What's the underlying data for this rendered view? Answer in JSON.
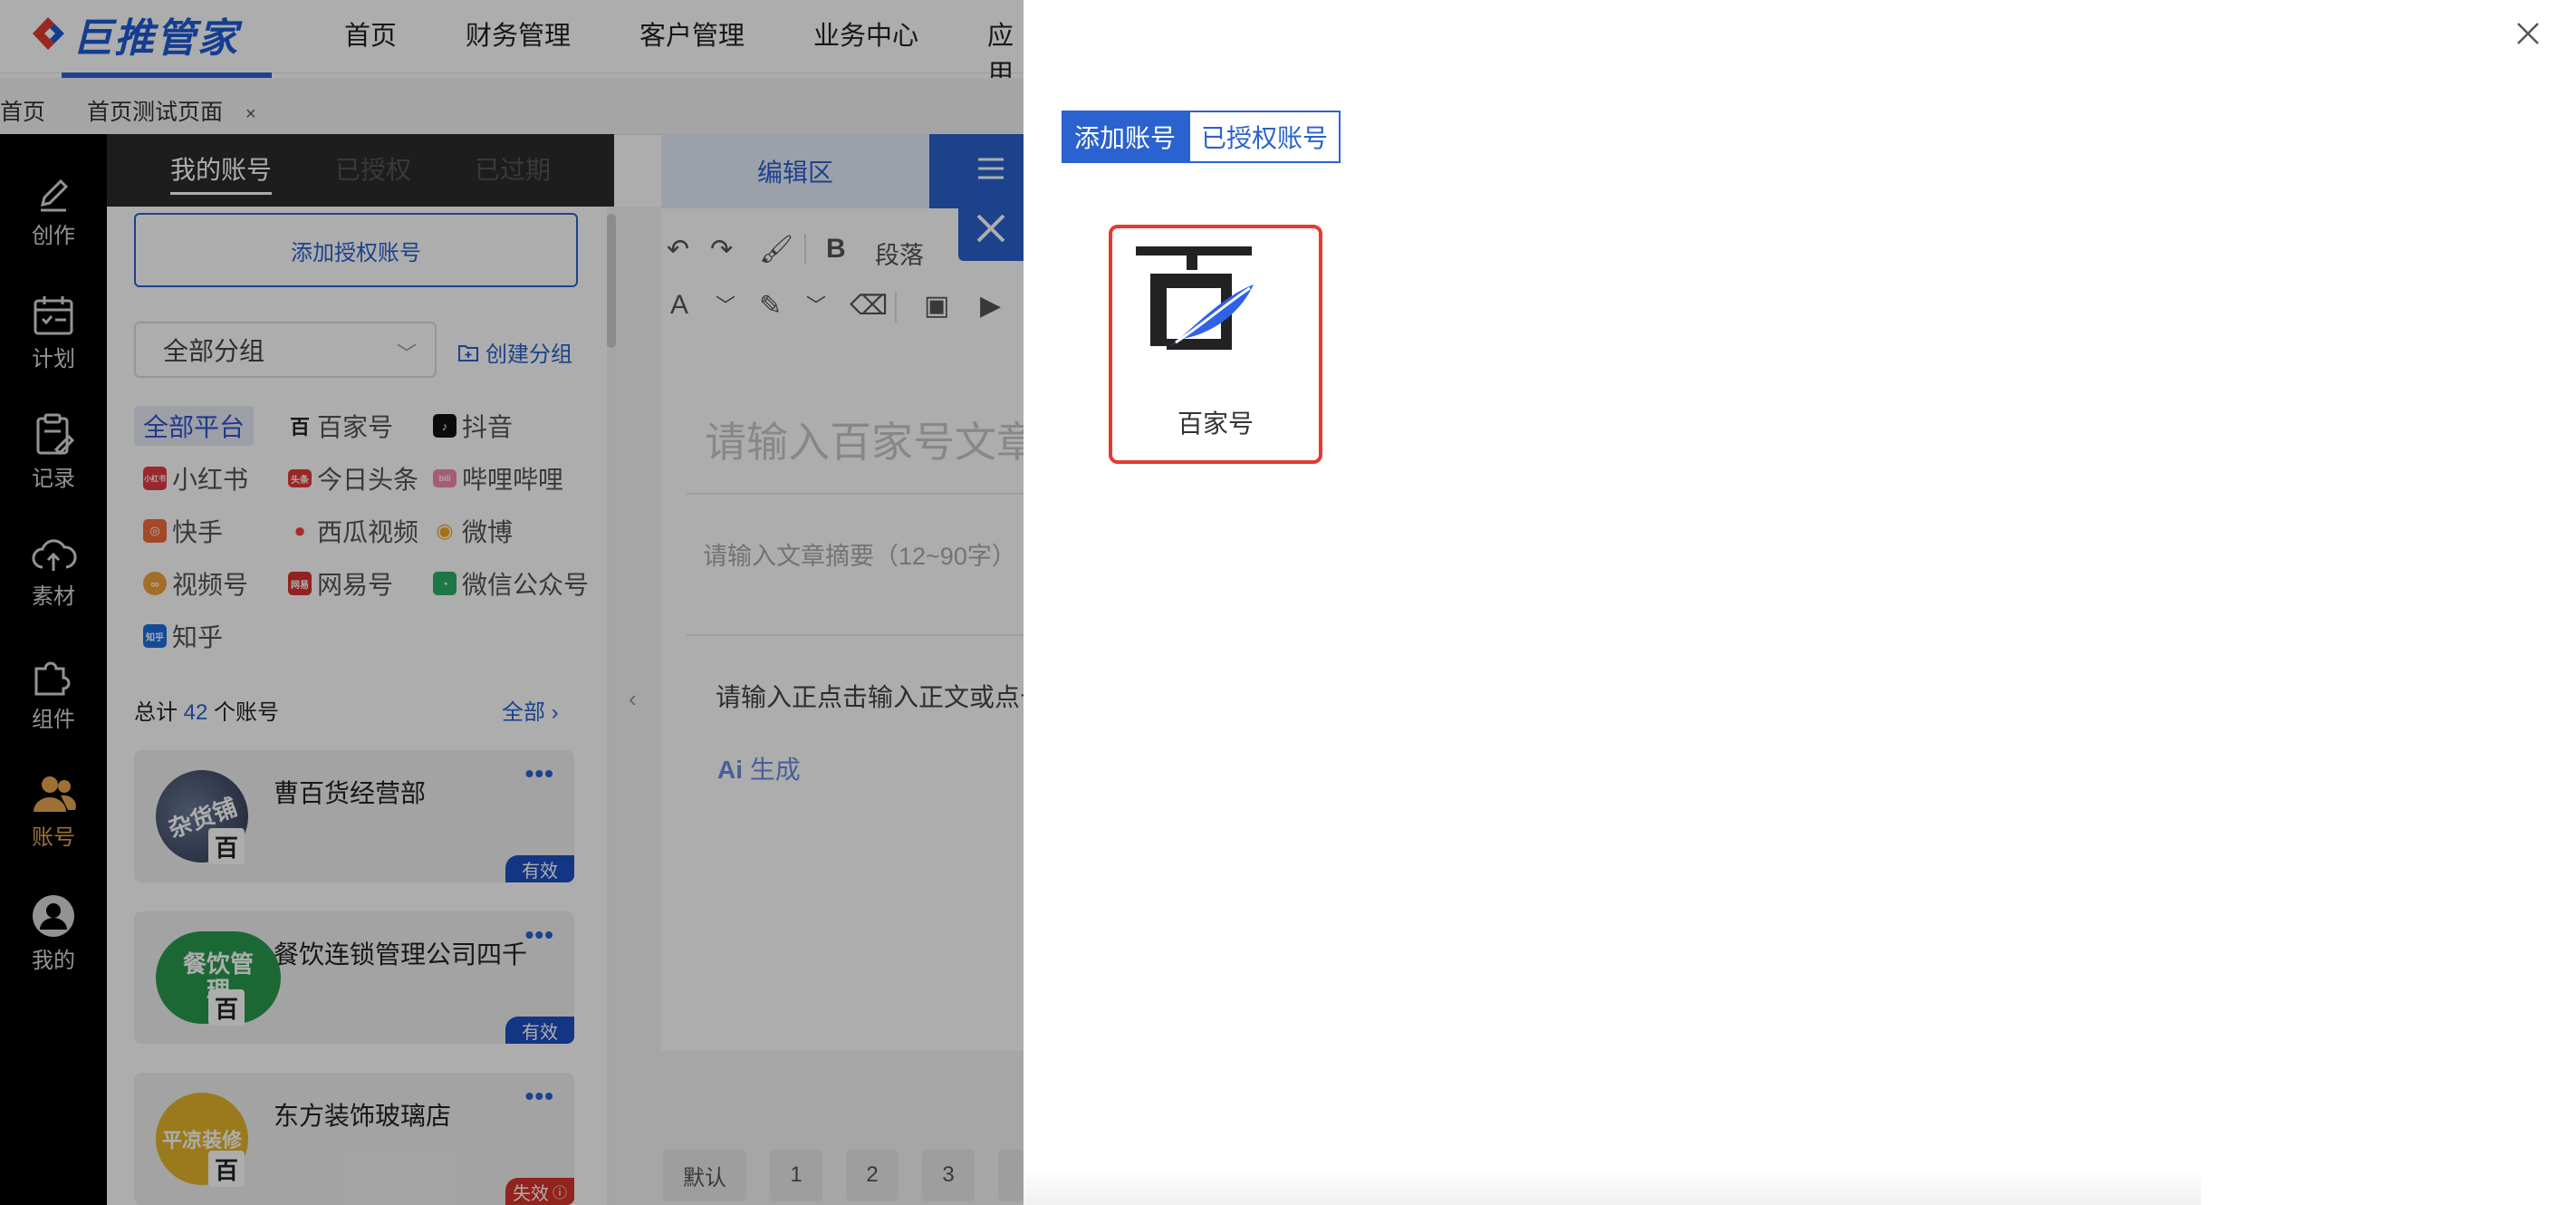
{
  "app": {
    "logo_text": "巨推管家"
  },
  "nav": [
    "首页",
    "财务管理",
    "客户管理",
    "业务中心",
    "应用"
  ],
  "tabs": {
    "home": "首页",
    "current": "首页测试页面",
    "close": "×"
  },
  "sidebar": [
    {
      "label": "创作",
      "icon": "pen-icon"
    },
    {
      "label": "计划",
      "icon": "calendar-icon"
    },
    {
      "label": "记录",
      "icon": "clipboard-icon"
    },
    {
      "label": "素材",
      "icon": "cloud-upload-icon"
    },
    {
      "label": "组件",
      "icon": "puzzle-icon"
    },
    {
      "label": "账号",
      "icon": "users-icon",
      "active": true
    },
    {
      "label": "我的",
      "icon": "user-icon"
    }
  ],
  "panel": {
    "tabs": [
      "我的账号",
      "已授权",
      "已过期"
    ],
    "add_auth": "添加授权账号",
    "group_select": "全部分组",
    "create_group": "创建分组",
    "platforms": [
      {
        "label": "全部平台",
        "active": true
      },
      {
        "label": "百家号",
        "icon": "百",
        "color": "#ffffff"
      },
      {
        "label": "抖音",
        "icon": "抖",
        "color": "#111111"
      },
      {
        "label": "小红书",
        "icon": "小红书",
        "color": "#e23b41"
      },
      {
        "label": "今日头条",
        "icon": "头条",
        "color": "#e53935"
      },
      {
        "label": "哔哩哔哩",
        "icon": "bili",
        "color": "#f28aa8"
      },
      {
        "label": "快手",
        "icon": "快",
        "color": "#f26b3a"
      },
      {
        "label": "西瓜视频",
        "icon": "瓜",
        "color": "#f0453a"
      },
      {
        "label": "微博",
        "icon": "微",
        "color": "#f5a623"
      },
      {
        "label": "视频号",
        "icon": "视",
        "color": "#f0a33b"
      },
      {
        "label": "网易号",
        "icon": "网易",
        "color": "#d6332e"
      },
      {
        "label": "微信公众号",
        "icon": "微",
        "color": "#2aae67"
      },
      {
        "label": "知乎",
        "icon": "知乎",
        "color": "#1e6fe0"
      }
    ],
    "total_prefix": "总计",
    "total_count": "42",
    "total_suffix": "个账号",
    "all_link": "全部",
    "accounts": [
      {
        "name": "曹百货经营部",
        "status": "有效",
        "status_color": "#1e4fc2",
        "avatar_text": "杂货铺",
        "avatar_color": "#3d4a66"
      },
      {
        "name": "餐饮连锁管理公司四千",
        "status": "有效",
        "status_color": "#1e4fc2",
        "avatar_text": "餐饮管理",
        "avatar_color": "#2a9a4f"
      },
      {
        "name": "东方装饰玻璃店",
        "status": "失效",
        "status_color": "#d9342b",
        "avatar_text": "平凉装修",
        "avatar_color": "#e3b42a"
      }
    ],
    "more": "•••"
  },
  "editor": {
    "tab": "编辑区",
    "toolbar_paragraph": "段落",
    "title_placeholder": "请输入百家号文章",
    "summary_placeholder": "请输入文章摘要（12~90字）",
    "body_placeholder": "请输入正点击输入正文或点击",
    "ai_generate": "生成",
    "ai_prefix": "Ai",
    "pagination": [
      "默认",
      "1",
      "2",
      "3"
    ]
  },
  "drawer": {
    "tabs": [
      "添加账号",
      "已授权账号"
    ],
    "platform_card": {
      "label": "百家号"
    }
  },
  "colors": {
    "accent": "#2a62cf",
    "danger": "#e53a2e",
    "sidebar_active": "#e8a74e"
  }
}
